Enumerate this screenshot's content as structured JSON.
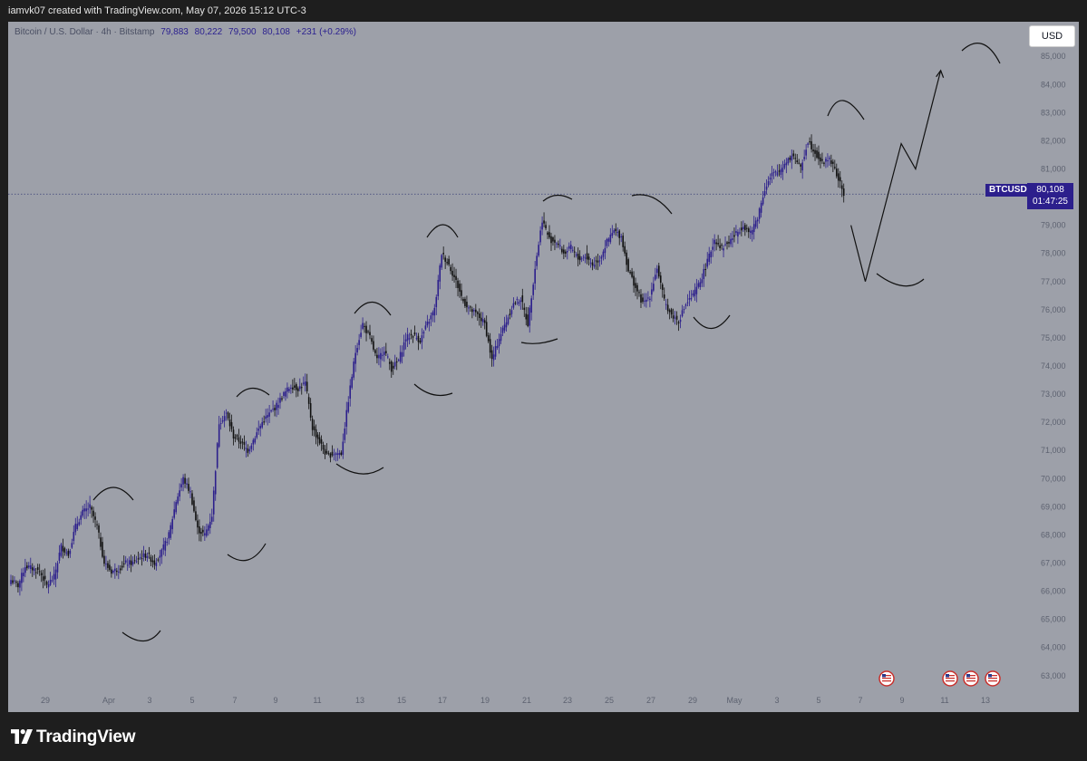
{
  "header": {
    "watermark": "iamvk07 created with TradingView.com, May 07, 2026 15:12 UTC-3"
  },
  "legend": {
    "symbol": "Bitcoin / U.S. Dollar · 4h · Bitstamp",
    "open": "79,883",
    "high": "80,222",
    "low": "79,500",
    "close": "80,108",
    "change": "+231 (+0.29%)"
  },
  "currency_button": "USD",
  "price_label": {
    "symbol": "BTCUSD",
    "price": "80,108",
    "countdown": "01:47:25"
  },
  "branding": {
    "logo_text": "TradingView"
  },
  "colors": {
    "background": "#9da0a9",
    "bull_candle": "#2c1f8c",
    "bear_candle": "#101010",
    "drawing": "#111111",
    "price_tag": "#2c1f8c"
  },
  "chart_data": {
    "type": "candlestick",
    "timeframe": "4h",
    "ylim": [
      62800,
      85200
    ],
    "y_ticks": [
      63000,
      64000,
      65000,
      66000,
      67000,
      68000,
      69000,
      70000,
      71000,
      72000,
      73000,
      74000,
      75000,
      76000,
      77000,
      78000,
      79000,
      80000,
      81000,
      82000,
      83000,
      84000,
      85000
    ],
    "x_ticks": [
      "29",
      "Apr",
      "3",
      "5",
      "7",
      "9",
      "11",
      "13",
      "15",
      "17",
      "19",
      "21",
      "23",
      "25",
      "27",
      "29",
      "May",
      "3",
      "5",
      "7",
      "9",
      "11",
      "13"
    ],
    "last_price": 80108,
    "candles_close_path": [
      [
        0,
        66400
      ],
      [
        4,
        66200
      ],
      [
        8,
        66900
      ],
      [
        12,
        66800
      ],
      [
        16,
        66700
      ],
      [
        20,
        66200
      ],
      [
        24,
        66500
      ],
      [
        28,
        67600
      ],
      [
        32,
        67300
      ],
      [
        36,
        68300
      ],
      [
        40,
        68800
      ],
      [
        44,
        69000
      ],
      [
        48,
        68300
      ],
      [
        52,
        67000
      ],
      [
        56,
        66700
      ],
      [
        60,
        66800
      ],
      [
        64,
        67000
      ],
      [
        68,
        67000
      ],
      [
        72,
        67200
      ],
      [
        76,
        67300
      ],
      [
        80,
        67000
      ],
      [
        84,
        67400
      ],
      [
        88,
        68000
      ],
      [
        92,
        69200
      ],
      [
        96,
        70000
      ],
      [
        100,
        69500
      ],
      [
        104,
        68200
      ],
      [
        108,
        68000
      ],
      [
        112,
        68700
      ],
      [
        116,
        72000
      ],
      [
        120,
        72300
      ],
      [
        124,
        71500
      ],
      [
        128,
        71300
      ],
      [
        132,
        71000
      ],
      [
        136,
        71500
      ],
      [
        140,
        72000
      ],
      [
        144,
        72300
      ],
      [
        148,
        72600
      ],
      [
        152,
        73000
      ],
      [
        156,
        73300
      ],
      [
        160,
        73200
      ],
      [
        164,
        73400
      ],
      [
        168,
        71800
      ],
      [
        172,
        71300
      ],
      [
        176,
        70800
      ],
      [
        180,
        70900
      ],
      [
        184,
        70900
      ],
      [
        188,
        72800
      ],
      [
        192,
        74500
      ],
      [
        196,
        75500
      ],
      [
        200,
        75000
      ],
      [
        204,
        74200
      ],
      [
        208,
        74600
      ],
      [
        212,
        73900
      ],
      [
        216,
        74200
      ],
      [
        220,
        75000
      ],
      [
        224,
        75100
      ],
      [
        228,
        74900
      ],
      [
        232,
        75500
      ],
      [
        236,
        76000
      ],
      [
        240,
        78000
      ],
      [
        244,
        77600
      ],
      [
        248,
        77000
      ],
      [
        252,
        76300
      ],
      [
        256,
        76000
      ],
      [
        260,
        75800
      ],
      [
        264,
        75500
      ],
      [
        268,
        74200
      ],
      [
        272,
        75000
      ],
      [
        276,
        75600
      ],
      [
        280,
        76200
      ],
      [
        284,
        76400
      ],
      [
        288,
        75500
      ],
      [
        292,
        77500
      ],
      [
        296,
        79200
      ],
      [
        300,
        78500
      ],
      [
        304,
        78400
      ],
      [
        308,
        78000
      ],
      [
        312,
        78200
      ],
      [
        316,
        77800
      ],
      [
        320,
        77900
      ],
      [
        324,
        77600
      ],
      [
        328,
        77800
      ],
      [
        332,
        78400
      ],
      [
        336,
        78800
      ],
      [
        340,
        78600
      ],
      [
        344,
        77400
      ],
      [
        348,
        76800
      ],
      [
        352,
        76200
      ],
      [
        356,
        76500
      ],
      [
        360,
        77500
      ],
      [
        364,
        76300
      ],
      [
        368,
        75800
      ],
      [
        372,
        75600
      ],
      [
        376,
        76200
      ],
      [
        380,
        76500
      ],
      [
        384,
        77000
      ],
      [
        388,
        77700
      ],
      [
        392,
        78500
      ],
      [
        396,
        78200
      ],
      [
        400,
        78400
      ],
      [
        404,
        78700
      ],
      [
        408,
        79000
      ],
      [
        412,
        78700
      ],
      [
        416,
        79300
      ],
      [
        420,
        80300
      ],
      [
        424,
        80800
      ],
      [
        428,
        80900
      ],
      [
        432,
        81300
      ],
      [
        436,
        81500
      ],
      [
        440,
        81000
      ],
      [
        444,
        82000
      ],
      [
        448,
        81600
      ],
      [
        452,
        81200
      ],
      [
        456,
        81400
      ],
      [
        460,
        80800
      ],
      [
        464,
        80108
      ]
    ],
    "projection": [
      {
        "bar": 468,
        "price": 79000
      },
      {
        "bar": 476,
        "price": 77000
      },
      {
        "bar": 496,
        "price": 81900
      },
      {
        "bar": 504,
        "price": 81000
      },
      {
        "bar": 518,
        "price": 84500
      }
    ],
    "annotations": "hand-drawn arcs marking local tops (∩) and bottoms (∪) of each swing"
  }
}
